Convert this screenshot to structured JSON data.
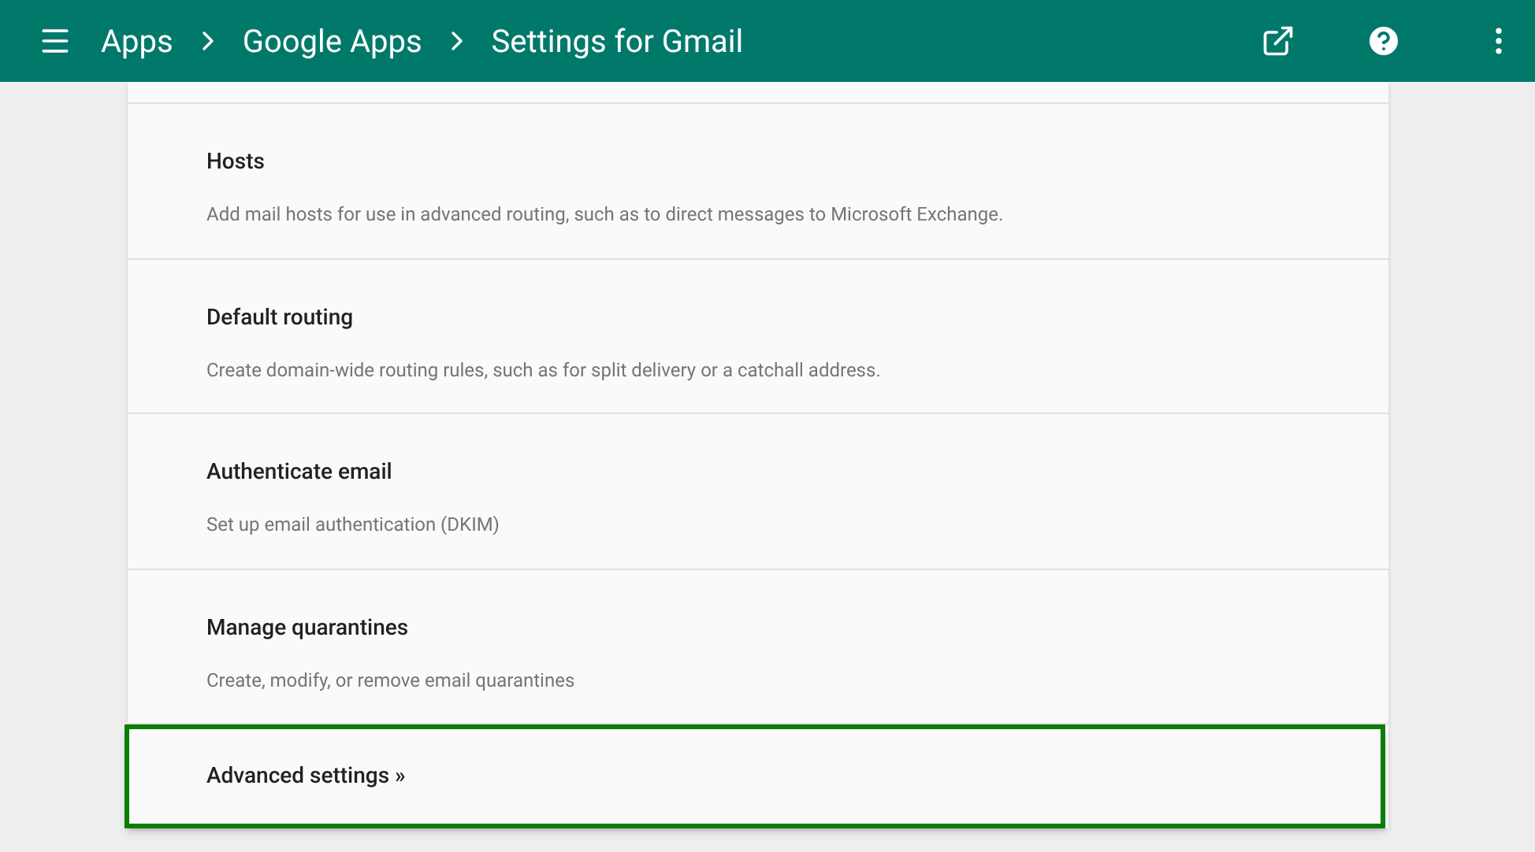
{
  "breadcrumb": [
    "Apps",
    "Google Apps",
    "Settings for Gmail"
  ],
  "sections": [
    {
      "title": "Hosts",
      "description": "Add mail hosts for use in advanced routing, such as to direct messages to Microsoft Exchange."
    },
    {
      "title": "Default routing",
      "description": "Create domain-wide routing rules, such as for split delivery or a catchall address."
    },
    {
      "title": "Authenticate email",
      "description": "Set up email authentication (DKIM)"
    },
    {
      "title": "Manage quarantines",
      "description": "Create, modify, or remove email quarantines"
    }
  ],
  "advanced": {
    "label": "Advanced settings »",
    "highlighted": true
  }
}
